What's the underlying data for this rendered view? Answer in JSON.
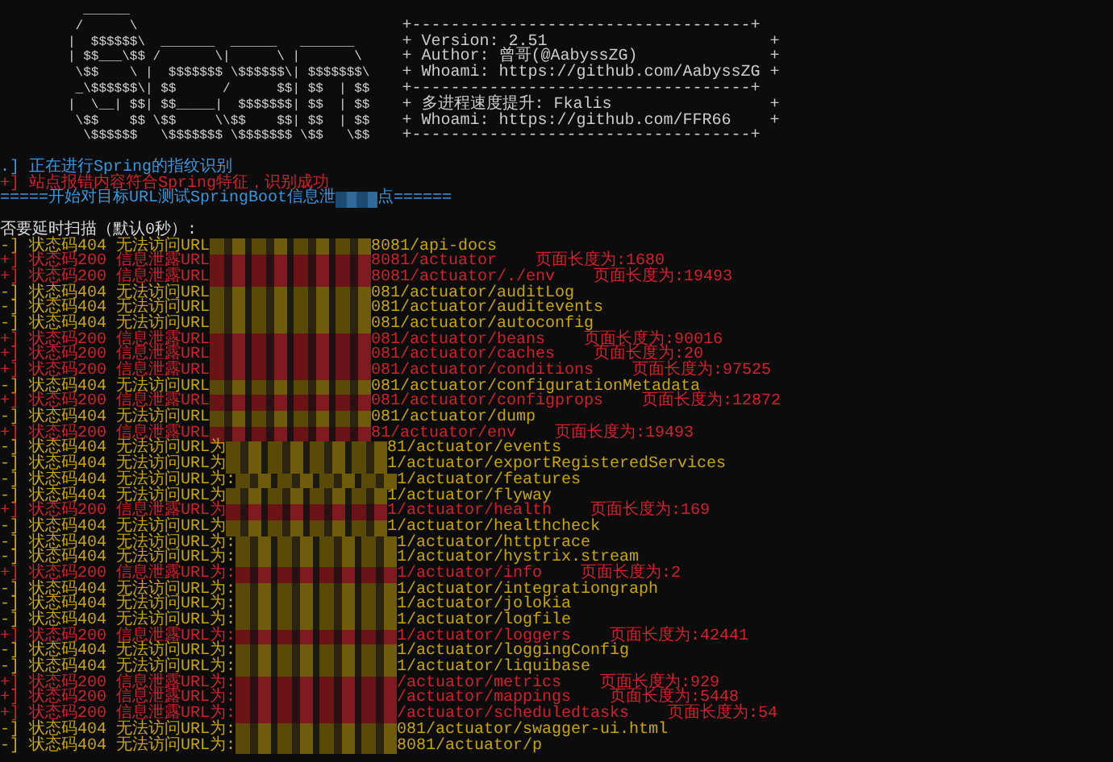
{
  "ascii_art": [
    "  ______",
    " /      \\",
    "|  $$$$$$\\  _______  ______   _______",
    "| $$___\\$$ /       \\|      \\ |       \\",
    " \\$$    \\ |  $$$$$$$ \\$$$$$$\\| $$$$$$$\\",
    " _\\$$$$$$\\| $$      /      $$| $$  | $$",
    "|  \\__| $$| $$_____|  $$$$$$$| $$  | $$",
    " \\$$    $$ \\$$     \\\\$$    $$| $$  | $$",
    "  \\$$$$$$   \\$$$$$$$ \\$$$$$$$ \\$$   \\$$"
  ],
  "info_box": [
    {
      "kind": "border",
      "text": "+-----------------------------------+"
    },
    {
      "kind": "line",
      "left": "+",
      "text": "Version: 2.51",
      "right": "+"
    },
    {
      "kind": "line",
      "left": "+",
      "text": "Author: 曾哥(@AabyssZG)",
      "right": "+"
    },
    {
      "kind": "line",
      "left": "+",
      "text": "Whoami: https://github.com/AabyssZG",
      "right": "+"
    },
    {
      "kind": "border",
      "text": "+-----------------------------------+"
    },
    {
      "kind": "line",
      "left": "+",
      "text": "多进程速度提升: Fkalis",
      "right": "+"
    },
    {
      "kind": "line",
      "left": "+",
      "text": "Whoami: https://github.com/FFR66",
      "right": "+"
    },
    {
      "kind": "border",
      "text": "+-----------------------------------+"
    }
  ],
  "messages": [
    {
      "kind": "info",
      "text": ".] 正在进行Spring的指纹识别"
    },
    {
      "kind": "success",
      "text": "+] 站点报错内容符合Spring特征，识别成功"
    },
    {
      "kind": "info",
      "text": "=====开始对目标URL测试SpringBoot信息泄",
      "after": "点======"
    },
    {
      "kind": "prompt",
      "text": "否要延时扫描（默认0秒）:"
    }
  ],
  "rows": [
    {
      "kind": "fail",
      "prefix": "-] 状态码404 无法访问URL",
      "path": "8081/api-docs"
    },
    {
      "kind": "leak",
      "prefix": "+] 状态码200 信息泄露URL",
      "path": "8081/actuator",
      "length": "页面长度为:1680"
    },
    {
      "kind": "leak",
      "prefix": "+] 状态码200 信息泄露URL",
      "path": "8081/actuator/./env",
      "length": "页面长度为:19493"
    },
    {
      "kind": "fail",
      "prefix": "-] 状态码404 无法访问URL",
      "path": "081/actuator/auditLog"
    },
    {
      "kind": "fail",
      "prefix": "-] 状态码404 无法访问URL",
      "path": "081/actuator/auditevents"
    },
    {
      "kind": "fail",
      "prefix": "-] 状态码404 无法访问URL",
      "path": "081/actuator/autoconfig"
    },
    {
      "kind": "leak",
      "prefix": "+] 状态码200 信息泄露URL",
      "path": "081/actuator/beans",
      "length": "页面长度为:90016"
    },
    {
      "kind": "leak",
      "prefix": "+] 状态码200 信息泄露URL",
      "path": "081/actuator/caches",
      "length": "页面长度为:20"
    },
    {
      "kind": "leak",
      "prefix": "+] 状态码200 信息泄露URL",
      "path": "081/actuator/conditions",
      "length": "页面长度为:97525"
    },
    {
      "kind": "fail",
      "prefix": "-] 状态码404 无法访问URL",
      "path": "081/actuator/configurationMetadata"
    },
    {
      "kind": "leak",
      "prefix": "+] 状态码200 信息泄露URL",
      "path": "081/actuator/configprops",
      "length": "页面长度为:12872"
    },
    {
      "kind": "fail",
      "prefix": "-] 状态码404 无法访问URL",
      "path": "081/actuator/dump"
    },
    {
      "kind": "leak",
      "prefix": "+] 状态码200 信息泄露URL",
      "path": "81/actuator/env",
      "length": "页面长度为:19493"
    },
    {
      "kind": "fail",
      "prefix": "-] 状态码404 无法访问URL为",
      "path": "81/actuator/events"
    },
    {
      "kind": "fail",
      "prefix": "-] 状态码404 无法访问URL为",
      "path": "1/actuator/exportRegisteredServices"
    },
    {
      "kind": "fail",
      "prefix": "-] 状态码404 无法访问URL为:",
      "path": "1/actuator/features"
    },
    {
      "kind": "fail",
      "prefix": "-] 状态码404 无法访问URL为",
      "path": "1/actuator/flyway"
    },
    {
      "kind": "leak",
      "prefix": "+] 状态码200 信息泄露URL为",
      "path": "1/actuator/health",
      "length": "页面长度为:169"
    },
    {
      "kind": "fail",
      "prefix": "-] 状态码404 无法访问URL为",
      "path": "1/actuator/healthcheck"
    },
    {
      "kind": "fail",
      "prefix": "-] 状态码404 无法访问URL为:",
      "path": "1/actuator/httptrace"
    },
    {
      "kind": "fail",
      "prefix": "-] 状态码404 无法访问URL为:",
      "path": "1/actuator/hystrix.stream"
    },
    {
      "kind": "leak",
      "prefix": "+] 状态码200 信息泄露URL为:",
      "path": "1/actuator/info",
      "length": "页面长度为:2"
    },
    {
      "kind": "fail",
      "prefix": "-] 状态码404 无法访问URL为:",
      "path": "1/actuator/integrationgraph"
    },
    {
      "kind": "fail",
      "prefix": "-] 状态码404 无法访问URL为:",
      "path": "1/actuator/jolokia"
    },
    {
      "kind": "fail",
      "prefix": "-] 状态码404 无法访问URL为:",
      "path": "1/actuator/logfile"
    },
    {
      "kind": "leak",
      "prefix": "+] 状态码200 信息泄露URL为:",
      "path": "1/actuator/loggers",
      "length": "页面长度为:42441"
    },
    {
      "kind": "fail",
      "prefix": "-] 状态码404 无法访问URL为:",
      "path": "1/actuator/loggingConfig"
    },
    {
      "kind": "fail",
      "prefix": "-] 状态码404 无法访问URL为:",
      "path": "1/actuator/liquibase"
    },
    {
      "kind": "leak",
      "prefix": "+] 状态码200 信息泄露URL为:",
      "path": "/actuator/metrics",
      "length": "页面长度为:929"
    },
    {
      "kind": "leak",
      "prefix": "+] 状态码200 信息泄露URL为:",
      "path": "/actuator/mappings",
      "length": "页面长度为:5448"
    },
    {
      "kind": "leak",
      "prefix": "+] 状态码200 信息泄露URL为:",
      "path": "/actuator/scheduledtasks",
      "length": "页面长度为:54"
    },
    {
      "kind": "fail",
      "prefix": "-] 状态码404 无法访问URL为:",
      "path": "081/actuator/swagger-ui.html"
    },
    {
      "kind": "fail",
      "prefix": "-] 状态码404 无法访问URL为:",
      "path": "8081/actuator/p"
    }
  ]
}
